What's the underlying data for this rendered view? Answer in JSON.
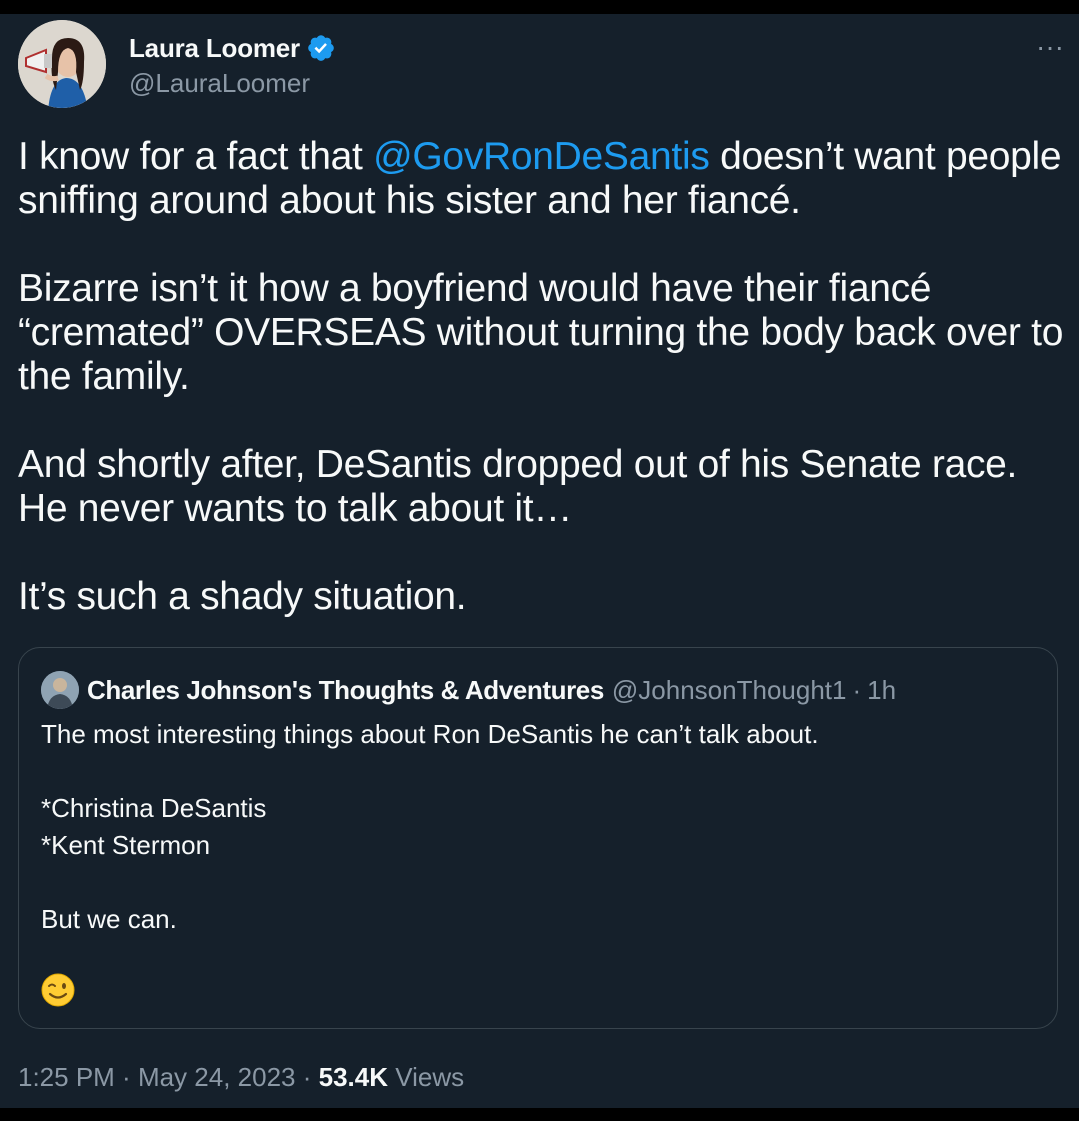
{
  "author": {
    "display_name": "Laura Loomer",
    "handle": "@LauraLoomer",
    "verified_icon": "verified-badge-icon"
  },
  "menu": {
    "more_icon": "more-options-icon",
    "more_glyph": "···"
  },
  "tweet": {
    "p1_before": "I know for a fact that ",
    "p1_mention": "@GovRonDeSantis",
    "p1_after": " doesn’t want people sniffing around about his sister and her fiancé.",
    "p2": "Bizarre isn’t it how a boyfriend would have their fiancé “cremated” OVERSEAS without turning the body back over to the family.",
    "p3": "And shortly after, DeSantis dropped out of his Senate race. He never wants to talk about it…",
    "p4": "It’s such a shady situation."
  },
  "quote": {
    "name": "Charles Johnson's Thoughts & Adventures",
    "handle": "@JohnsonThought1",
    "separator": "·",
    "time": "1h",
    "line1": "The most interesting things about Ron DeSantis he can’t talk about.",
    "line2": "*Christina DeSantis",
    "line3": "*Kent Stermon",
    "line4": "But we can.",
    "emoji_icon": "winking-face-icon"
  },
  "meta": {
    "time": "1:25 PM",
    "sep1": " · ",
    "date": "May 24, 2023",
    "sep2": " · ",
    "views_count": "53.4K",
    "views_label": " Views"
  },
  "colors": {
    "background": "#15202b",
    "text": "#f7f9f9",
    "secondary": "#8b98a5",
    "accent": "#1d9bf0",
    "border": "#38444d"
  }
}
